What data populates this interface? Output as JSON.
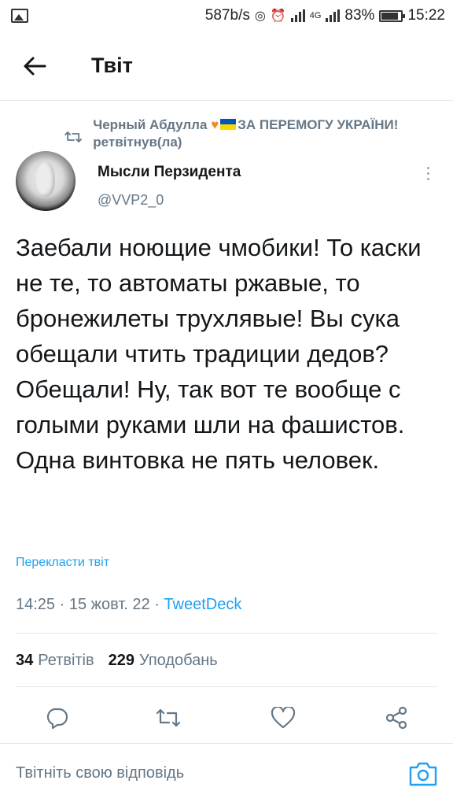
{
  "status_bar": {
    "net_speed": "587b/s",
    "battery": "83%",
    "time": "15:22",
    "network_label": "4G"
  },
  "header": {
    "title": "Твіт"
  },
  "retweet": {
    "name": "Черный Абдулла",
    "slogan": "ЗА ПЕРЕМОГУ УКРАЇНИ!",
    "action": " ретвітнув(ла)"
  },
  "author": {
    "name": "Мысли Перзидента",
    "handle": "@VVP2_0"
  },
  "tweet": {
    "text": "Заебали ноющие чмобики! То каски не те, то автоматы ржавые, то бронежилеты трухлявые! Вы сука обещали чтить традиции дедов? Обещали! Ну, так вот те вообще с голыми руками шли на фашистов. Одна винтовка не пять человек.",
    "translate_label": "Перекласти твіт",
    "time": "14:25",
    "date": "15 жовт. 22",
    "separator": " · ",
    "source": "TweetDeck"
  },
  "stats": {
    "retweets_count": "34",
    "retweets_label": "Ретвітів",
    "likes_count": "229",
    "likes_label": "Уподобань"
  },
  "reply": {
    "placeholder": "Твітніть свою відповідь"
  },
  "colors": {
    "accent": "#1da1f2",
    "secondary_text": "#657786",
    "divider": "#e1e8ed",
    "heart_emoji": "#f28c28",
    "flag_blue": "#0057b7",
    "flag_yellow": "#ffd700"
  },
  "icons": [
    "back-arrow-icon",
    "retweet-icon",
    "more-vertical-icon",
    "reply-icon",
    "retweet-action-icon",
    "like-icon",
    "share-icon",
    "camera-icon"
  ]
}
